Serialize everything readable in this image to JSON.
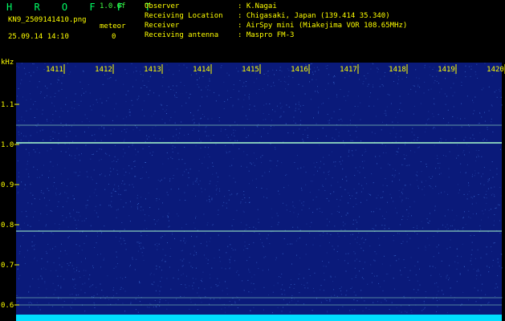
{
  "header": {
    "logo_letters": "H R O F F T",
    "version": "1.0.0f",
    "filename": "KN9_2509141410.png",
    "timestamp": "25.09.14 14:10",
    "meteor_label": "meteor",
    "meteor_count": "0",
    "info": [
      {
        "key": "Observer",
        "value": ": K.Nagai"
      },
      {
        "key": "Receiving Location",
        "value": ": Chigasaki, Japan (139.414 35.340)"
      },
      {
        "key": "Receiver",
        "value": ": AirSpy mini (Miakejima VOR 108.65MHz)"
      },
      {
        "key": "Receiving antenna",
        "value": ": Maspro FM-3"
      }
    ]
  },
  "spectrogram": {
    "unit_label": "kHz",
    "time_ticks": [
      "1411",
      "1412",
      "1413",
      "1414",
      "1415",
      "1416",
      "1417",
      "1418",
      "1419",
      "1420"
    ],
    "freq_ticks": [
      "1.1",
      "1.0",
      "0.9",
      "0.8",
      "0.7",
      "0.6"
    ],
    "colors": {
      "background": "#0a1a7a",
      "noise": "#3a6ad0",
      "line": "#aaffcc",
      "axis": "#ffff00",
      "floor": "#00ddff"
    }
  }
}
